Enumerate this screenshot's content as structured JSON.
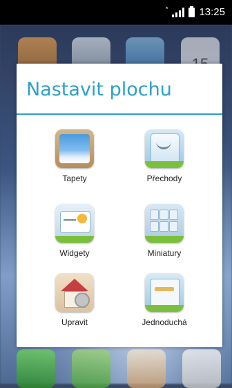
{
  "status_bar": {
    "sim_indicator": "*",
    "time": "13:25"
  },
  "background": {
    "calendar_day": "15"
  },
  "dialog": {
    "title": "Nastavit plochu",
    "options": [
      {
        "label": "Tapety",
        "icon": "wallpaper-icon"
      },
      {
        "label": "Přechody",
        "icon": "transitions-icon"
      },
      {
        "label": "Widgety",
        "icon": "widgets-icon"
      },
      {
        "label": "Miniatury",
        "icon": "thumbnails-icon"
      },
      {
        "label": "Upravit",
        "icon": "edit-home-icon"
      },
      {
        "label": "Jednoduchá",
        "icon": "simple-home-icon"
      }
    ]
  },
  "colors": {
    "accent": "#2ca0c8",
    "status_bar_bg": "#000000",
    "dialog_bg": "#ffffff"
  }
}
